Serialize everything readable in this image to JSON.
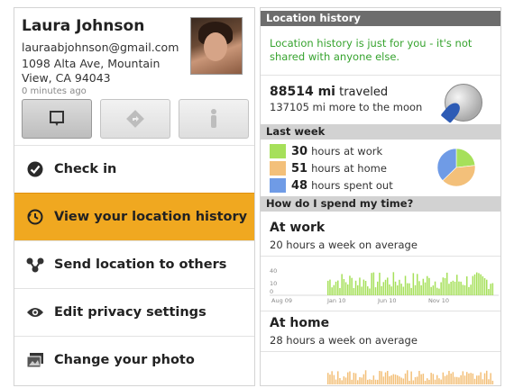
{
  "profile": {
    "name": "Laura Johnson",
    "email": "lauraabjohnson@gmail.com",
    "address": "1098 Alta Ave, Mountain View, CA 94043",
    "updated": "0 minutes ago"
  },
  "actions": [
    {
      "icon": "map-marker-icon",
      "active": true
    },
    {
      "icon": "directions-icon",
      "active": false
    },
    {
      "icon": "street-view-icon",
      "active": false
    }
  ],
  "menu": [
    {
      "label": "Check in",
      "icon": "checkmark-icon",
      "selected": false
    },
    {
      "label": "View your location history",
      "icon": "history-icon",
      "selected": true
    },
    {
      "label": "Send location to others",
      "icon": "share-icon",
      "selected": false
    },
    {
      "label": "Edit privacy settings",
      "icon": "eye-icon",
      "selected": false
    },
    {
      "label": "Change your photo",
      "icon": "photo-icon",
      "selected": false
    }
  ],
  "history": {
    "title": "Location history",
    "note": "Location history is just for you - it's not shared with anyone else.",
    "distance_value": "88514 mi",
    "distance_label": "traveled",
    "moon_text": "137105 mi more to the moon",
    "last_week_title": "Last week",
    "breakdown": [
      {
        "value": "30",
        "label": "hours at work",
        "color": "#a6e05a"
      },
      {
        "value": "51",
        "label": "hours at home",
        "color": "#f3c07a"
      },
      {
        "value": "48",
        "label": "hours spent out",
        "color": "#6f9be6"
      }
    ],
    "spend_title": "How do I spend my time?",
    "sections": [
      {
        "title": "At work",
        "subtitle": "20 hours a week on average",
        "color": "#a6e05a",
        "ticks": [
          "40",
          "10",
          "0"
        ],
        "dates": [
          "Aug 09",
          "Jan 10",
          "Jun 10",
          "Nov 10"
        ]
      },
      {
        "title": "At home",
        "subtitle": "28 hours a week on average",
        "color": "#f3c07a"
      }
    ]
  }
}
